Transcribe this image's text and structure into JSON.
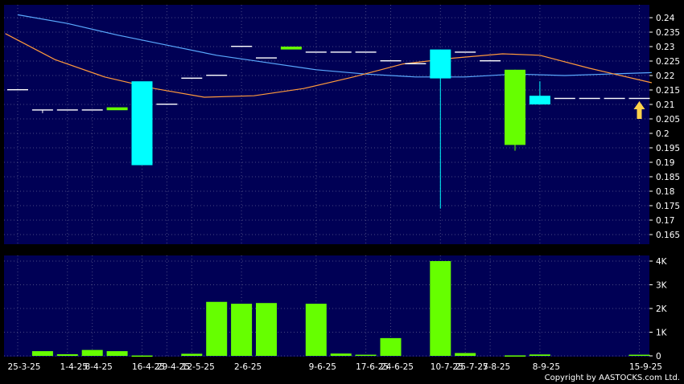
{
  "copyright": "Copyright by AASTOCKS.com Ltd.",
  "colors": {
    "panel_bg": "#000055",
    "grid": "#7a7aa0",
    "up_candle": "#00ffff",
    "down_candle": "#66ff00",
    "flat_tick": "#ffffff",
    "ma_blue": "#5aaaff",
    "ma_orange": "#ff9a3c",
    "volume_bar": "#66ff00",
    "arrow": "#ffd24a"
  },
  "chart_data": [
    {
      "type": "candlestick",
      "name": "price",
      "ylim": [
        0.16,
        0.2425
      ],
      "y_ticks": [
        "0.24",
        "0.235",
        "0.23",
        "0.225",
        "0.22",
        "0.215",
        "0.21",
        "0.205",
        "0.2",
        "0.195",
        "0.19",
        "0.185",
        "0.18",
        "0.175",
        "0.17",
        "0.165"
      ],
      "candles": [
        {
          "o": 0.215,
          "h": 0.215,
          "l": 0.215,
          "c": 0.215
        },
        {
          "o": 0.208,
          "h": 0.208,
          "l": 0.207,
          "c": 0.208
        },
        {
          "o": 0.208,
          "h": 0.208,
          "l": 0.208,
          "c": 0.208
        },
        {
          "o": 0.208,
          "h": 0.208,
          "l": 0.208,
          "c": 0.208
        },
        {
          "o": 0.209,
          "h": 0.209,
          "l": 0.208,
          "c": 0.208
        },
        {
          "o": 0.189,
          "h": 0.218,
          "l": 0.189,
          "c": 0.218
        },
        {
          "o": 0.21,
          "h": 0.21,
          "l": 0.21,
          "c": 0.21
        },
        {
          "o": 0.219,
          "h": 0.219,
          "l": 0.219,
          "c": 0.219
        },
        {
          "o": 0.22,
          "h": 0.22,
          "l": 0.22,
          "c": 0.22
        },
        {
          "o": 0.23,
          "h": 0.23,
          "l": 0.23,
          "c": 0.23
        },
        {
          "o": 0.226,
          "h": 0.226,
          "l": 0.226,
          "c": 0.226
        },
        {
          "o": 0.23,
          "h": 0.23,
          "l": 0.229,
          "c": 0.229
        },
        {
          "o": 0.228,
          "h": 0.228,
          "l": 0.228,
          "c": 0.228
        },
        {
          "o": 0.228,
          "h": 0.228,
          "l": 0.228,
          "c": 0.228
        },
        {
          "o": 0.228,
          "h": 0.228,
          "l": 0.228,
          "c": 0.228
        },
        {
          "o": 0.225,
          "h": 0.225,
          "l": 0.225,
          "c": 0.225
        },
        {
          "o": 0.224,
          "h": 0.224,
          "l": 0.224,
          "c": 0.224
        },
        {
          "o": 0.219,
          "h": 0.229,
          "l": 0.174,
          "c": 0.229
        },
        {
          "o": 0.228,
          "h": 0.228,
          "l": 0.228,
          "c": 0.228
        },
        {
          "o": 0.225,
          "h": 0.225,
          "l": 0.225,
          "c": 0.225
        },
        {
          "o": 0.222,
          "h": 0.222,
          "l": 0.194,
          "c": 0.196
        },
        {
          "o": 0.21,
          "h": 0.218,
          "l": 0.21,
          "c": 0.213
        },
        {
          "o": 0.212,
          "h": 0.212,
          "l": 0.212,
          "c": 0.212
        },
        {
          "o": 0.212,
          "h": 0.212,
          "l": 0.212,
          "c": 0.212
        },
        {
          "o": 0.212,
          "h": 0.212,
          "l": 0.212,
          "c": 0.212
        },
        {
          "o": 0.212,
          "h": 0.212,
          "l": 0.212,
          "c": 0.212
        }
      ],
      "ma_lines": [
        {
          "color": "#5aaaff",
          "x": [
            0,
            2,
            4,
            6,
            8,
            10,
            12,
            14,
            16,
            18,
            20,
            22,
            25.5
          ],
          "y": [
            0.241,
            0.238,
            0.234,
            0.2305,
            0.227,
            0.2245,
            0.222,
            0.2205,
            0.2195,
            0.2195,
            0.2205,
            0.22,
            0.221
          ]
        },
        {
          "color": "#ff9a3c",
          "x": [
            -0.5,
            1.5,
            3.5,
            5.5,
            7.5,
            9.5,
            11.5,
            13.5,
            15.5,
            17.5,
            19.5,
            21,
            23,
            25.5
          ],
          "y": [
            0.2345,
            0.2255,
            0.2195,
            0.2155,
            0.2125,
            0.213,
            0.2155,
            0.2195,
            0.224,
            0.226,
            0.2275,
            0.227,
            0.2225,
            0.2175
          ]
        }
      ],
      "annotation": {
        "x": 25,
        "y": 0.205,
        "shape": "up-arrow"
      }
    },
    {
      "type": "bar",
      "name": "volume",
      "ylim": [
        0,
        4200
      ],
      "y_ticks": [
        {
          "label": "4K",
          "value": 4000
        },
        {
          "label": "3K",
          "value": 3000
        },
        {
          "label": "2K",
          "value": 2000
        },
        {
          "label": "1K",
          "value": 1000
        },
        {
          "label": "0",
          "value": 0
        }
      ],
      "values": [
        0,
        200,
        70,
        250,
        200,
        15,
        0,
        90,
        2280,
        2200,
        2230,
        0,
        2200,
        100,
        50,
        750,
        0,
        4000,
        120,
        0,
        20,
        60,
        0,
        0,
        0,
        50
      ]
    }
  ],
  "x_ticks": [
    {
      "label": "25-3-25",
      "index": 0
    },
    {
      "label": "1-4-25",
      "index": 2
    },
    {
      "label": "8-4-25",
      "index": 3
    },
    {
      "label": "16-4-25",
      "index": 5
    },
    {
      "label": "29-4-25",
      "index": 6
    },
    {
      "label": "12-5-25",
      "index": 7
    },
    {
      "label": "2-6-25",
      "index": 9
    },
    {
      "label": "9-6-25",
      "index": 12
    },
    {
      "label": "17-6-25",
      "index": 14
    },
    {
      "label": "24-6-25",
      "index": 15
    },
    {
      "label": "10-7-25",
      "index": 17
    },
    {
      "label": "25-7-25",
      "index": 18
    },
    {
      "label": "7-8-25",
      "index": 19
    },
    {
      "label": "8-9-25",
      "index": 21
    },
    {
      "label": "15-9-25",
      "index": 25
    }
  ]
}
